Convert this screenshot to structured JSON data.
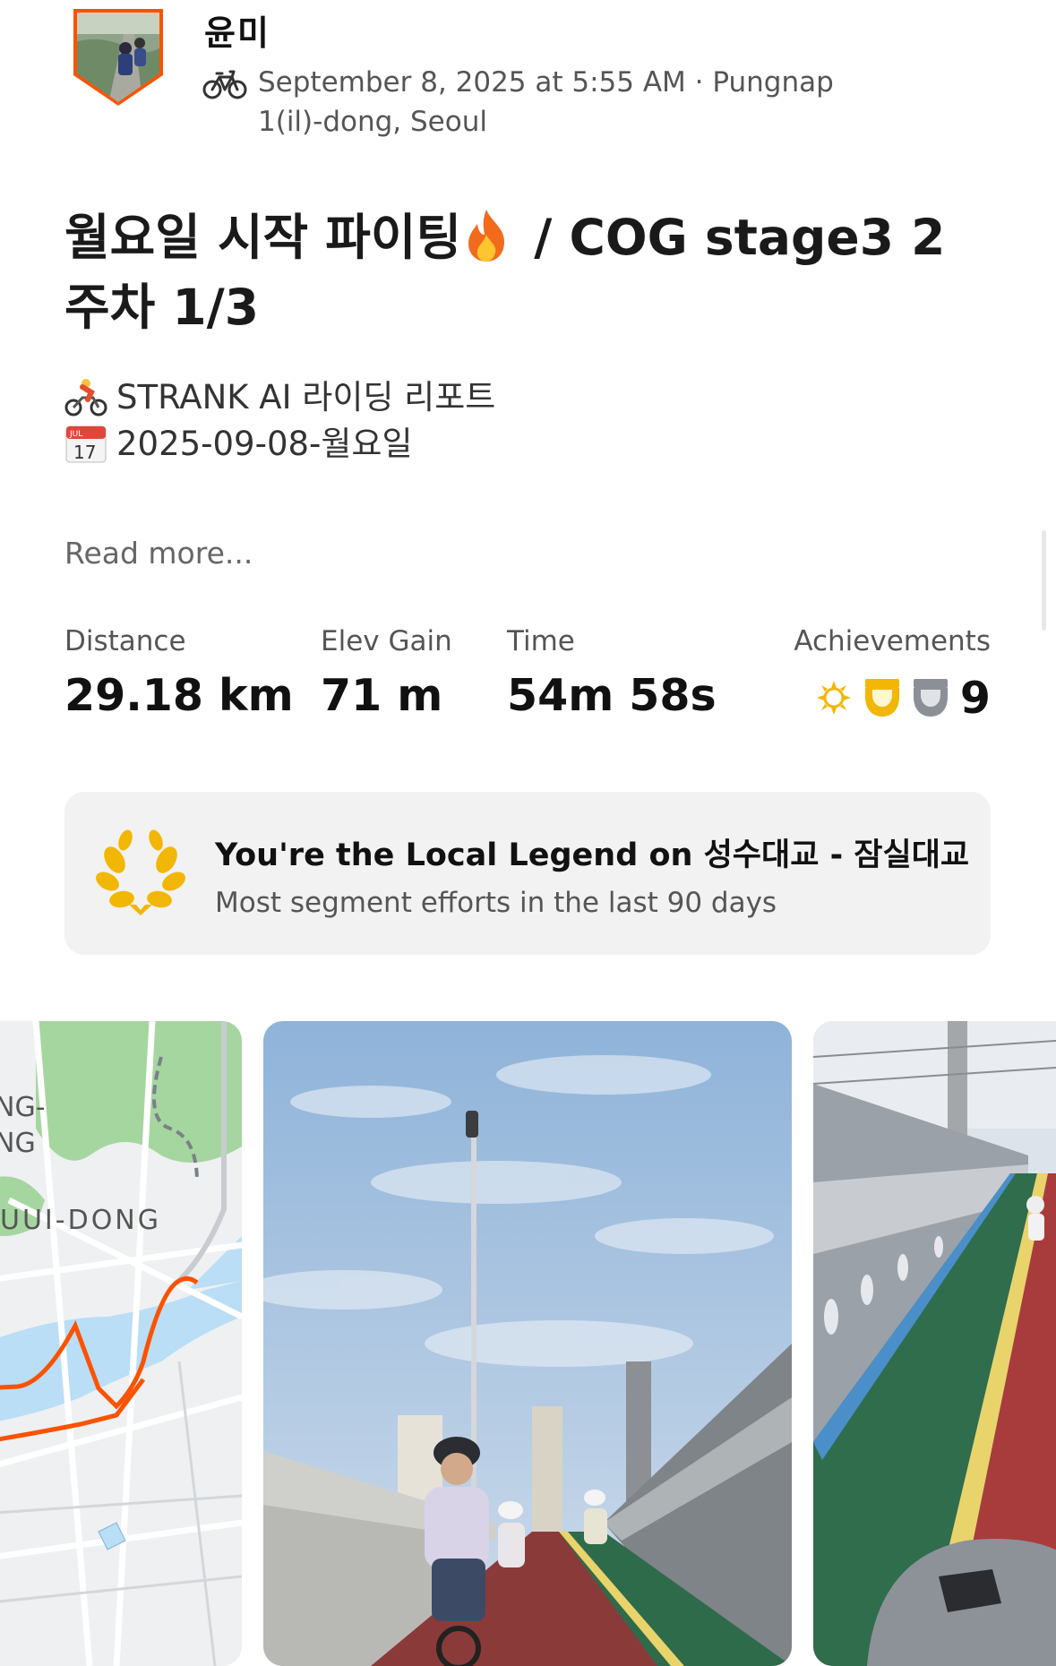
{
  "header": {
    "athlete_name": "윤미",
    "meta_text": "September 8, 2025 at 5:55 AM · Pungnap 1(il)-dong, Seoul",
    "activity_icon": "bike-icon"
  },
  "activity": {
    "title_part1": "월요일 시작 파이팅",
    "title_part2": " / COG stage3 2 주차 1/3",
    "description_line1": "STRANK AI 라이딩 리포트",
    "description_line2": "2025-09-08-월요일",
    "calendar_month": "JUL",
    "calendar_day": "17",
    "read_more": "Read more..."
  },
  "stats": {
    "distance": {
      "label": "Distance",
      "value": "29.18 km"
    },
    "elev_gain": {
      "label": "Elev Gain",
      "value": "71 m"
    },
    "time": {
      "label": "Time",
      "value": "54m 58s"
    },
    "achievements": {
      "label": "Achievements",
      "count": "9",
      "icons": [
        "laurel-icon",
        "gold-trophy-icon",
        "silver-trophy-icon"
      ]
    }
  },
  "legend": {
    "title": "You're the Local Legend on 성수대교 - 잠실대교",
    "subtitle": "Most segment efforts in the last 90 days"
  },
  "map": {
    "labels": [
      "NG-",
      "NG",
      "UUI-DONG"
    ]
  },
  "colors": {
    "brand_orange": "#fc5200",
    "gold": "#f2b705",
    "silver": "#8a9096",
    "card_bg": "#f2f2f2"
  }
}
